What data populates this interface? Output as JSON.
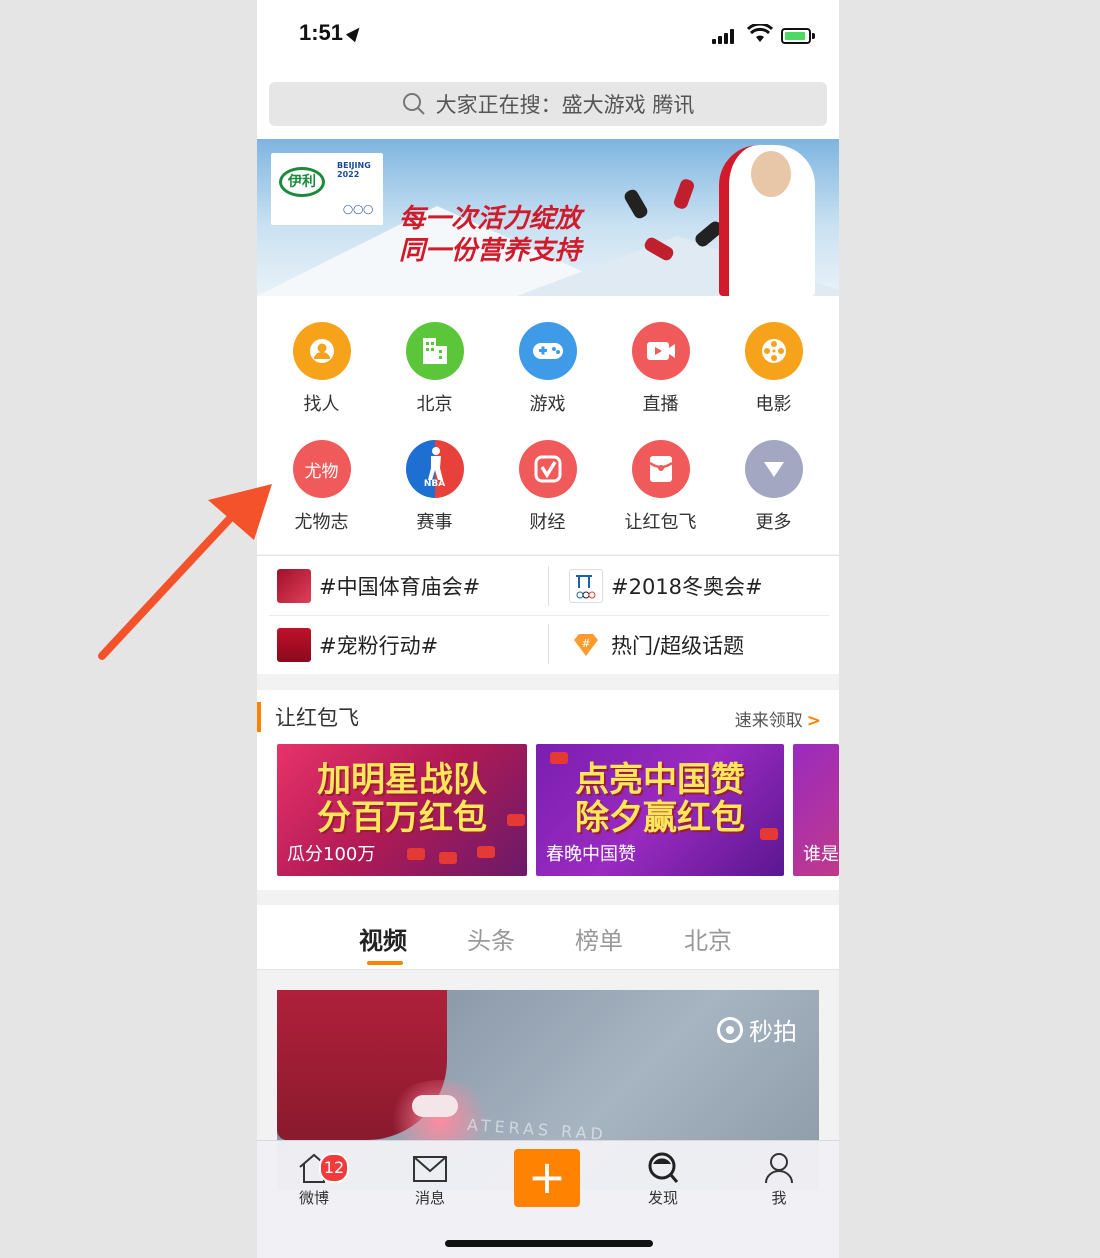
{
  "status": {
    "time": "1:51"
  },
  "search": {
    "placeholder": "大家正在搜：盛大游戏 腾讯"
  },
  "banner": {
    "brand": "伊利",
    "olympic": "BEIJING 2022",
    "slogan_line1": "每一次活力绽放",
    "slogan_line2": "同一份营养支持"
  },
  "grid": {
    "row1": [
      {
        "label": "找人",
        "icon": "person-icon",
        "color": "#f7a21b"
      },
      {
        "label": "北京",
        "icon": "building-icon",
        "color": "#5bc63a"
      },
      {
        "label": "游戏",
        "icon": "gamepad-icon",
        "color": "#3f9be8"
      },
      {
        "label": "直播",
        "icon": "video-camera-icon",
        "color": "#f05a5a"
      },
      {
        "label": "电影",
        "icon": "film-reel-icon",
        "color": "#f7a21b"
      }
    ],
    "row2": [
      {
        "label": "尤物志",
        "icon": "youwu-logo-icon",
        "color": "#f05a5a",
        "glyph": "尤物"
      },
      {
        "label": "赛事",
        "icon": "nba-logo-icon",
        "color": "#1d6fd1",
        "glyph": "NBA"
      },
      {
        "label": "财经",
        "icon": "finance-check-icon",
        "color": "#f05a5a"
      },
      {
        "label": "让红包飞",
        "icon": "red-packet-icon",
        "color": "#f05a5a"
      },
      {
        "label": "更多",
        "icon": "triangle-down-icon",
        "color": "#a3a7c2"
      }
    ]
  },
  "topics": [
    {
      "label": "#中国体育庙会#"
    },
    {
      "label": "#2018冬奥会#"
    },
    {
      "label": "#宠粉行动#"
    },
    {
      "label": "热门/超级话题"
    }
  ],
  "redpacket": {
    "title": "让红包飞",
    "more": "速来领取",
    "cards": [
      {
        "headline1": "加明星战队",
        "headline2": "分百万红包",
        "caption": "瓜分100万"
      },
      {
        "headline1": "点亮中国赞",
        "headline2": "除夕赢红包",
        "caption": "春晚中国赞"
      },
      {
        "headline1": "",
        "headline2": "",
        "caption": "谁是"
      }
    ]
  },
  "tabs": [
    "视频",
    "头条",
    "榜单",
    "北京"
  ],
  "video": {
    "watermark": "秒拍",
    "ground_text": "ATERAS RAD"
  },
  "nav": {
    "items": [
      {
        "label": "微博",
        "icon": "home-icon",
        "badge": "12"
      },
      {
        "label": "消息",
        "icon": "envelope-icon"
      },
      {
        "label": "",
        "icon": "plus-icon",
        "glyph": "+"
      },
      {
        "label": "发现",
        "icon": "discover-search-icon"
      },
      {
        "label": "我",
        "icon": "profile-icon"
      }
    ]
  },
  "colors": {
    "accent": "#ff8200",
    "annotation_arrow": "#f4522b"
  }
}
